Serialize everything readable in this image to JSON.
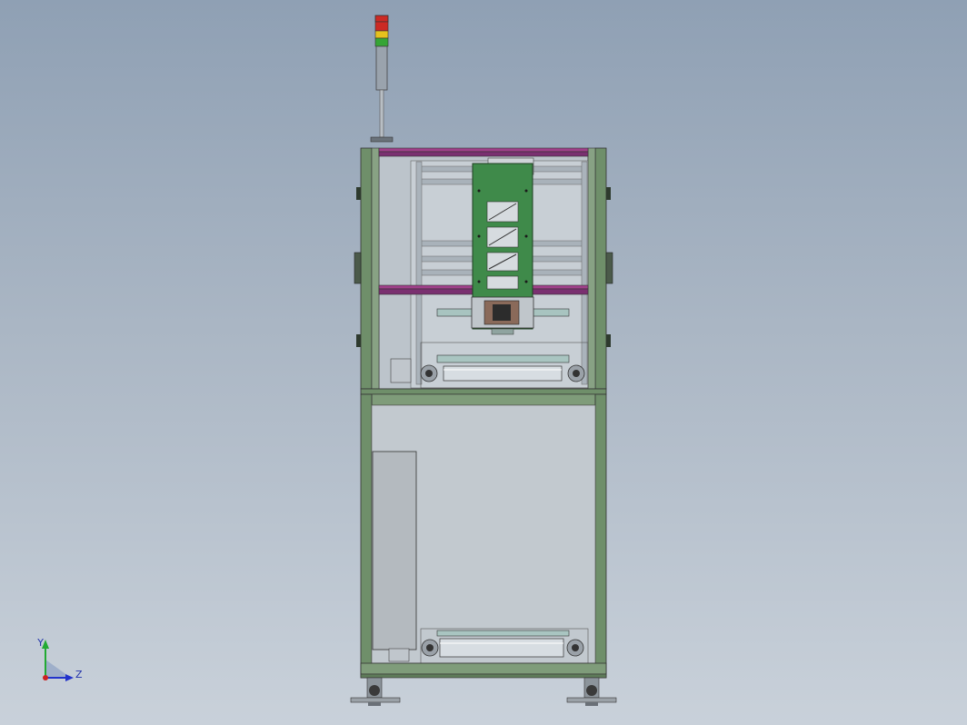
{
  "viewport": {
    "background_top": "#8fa0b4",
    "background_bottom": "#c9d1da"
  },
  "triad": {
    "y_label": "Y",
    "z_label": "Z",
    "y_color": "#22aa33",
    "z_color": "#2233cc",
    "origin_color": "#cc2222"
  },
  "machine": {
    "frame_color": "#6f8f6a",
    "accent_rail_color": "#a0408a",
    "plate_color": "#3f8a4a",
    "signal_tower": {
      "lamps": [
        "#d23a2a",
        "#e8c020",
        "#3ab03a"
      ]
    }
  }
}
